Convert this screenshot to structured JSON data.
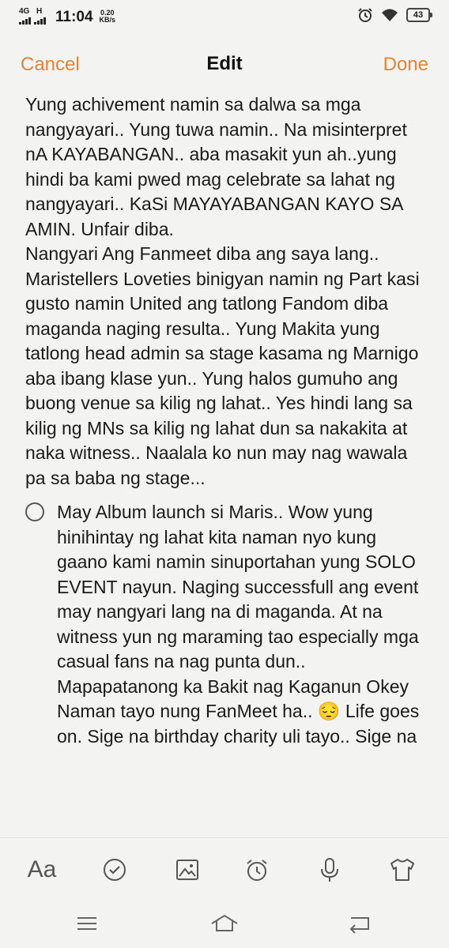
{
  "status_bar": {
    "network_type": "4G",
    "network_sub": "H",
    "time": "11:04",
    "speed_value": "0.20",
    "speed_unit": "KB/s",
    "battery": "43",
    "icons": [
      "signal-bars-icon",
      "alarm-clock-icon",
      "wifi-icon",
      "battery-icon"
    ]
  },
  "nav": {
    "cancel_label": "Cancel",
    "title": "Edit",
    "done_label": "Done",
    "accent_color": "#e0853a"
  },
  "note": {
    "paragraphs": [
      "Yung achivement namin sa dalwa sa mga nangyayari.. Yung tuwa namin.. Na misinterpret nA KAYABANGAN.. aba masakit yun ah..yung hindi ba kami pwed mag celebrate sa lahat ng nangyayari.. KaSi MAYAYABANGAN KAYO SA AMIN. Unfair diba.",
      "Nangyari Ang Fanmeet diba ang saya lang.. Maristellers Loveties binigyan namin ng Part kasi gusto namin United ang tatlong Fandom diba maganda naging resulta.. Yung Makita yung tatlong head admin sa stage kasama ng Marnigo aba ibang klase yun.. Yung halos gumuho ang buong venue sa kilig ng lahat.. Yes hindi lang sa kilig ng MNs sa kilig ng lahat dun sa nakakita at naka witness.. Naalala ko nun may nag wawala pa sa baba ng stage..."
    ],
    "checklist_item": "May Album launch si Maris.. Wow yung hinihintay ng lahat kita naman nyo kung gaano kami namin sinuportahan yung SOLO EVENT nayun. Naging successfull ang event may nangyari lang na di maganda. At na witness yun ng maraming tao especially mga casual fans na nag punta dun.. Mapapatanong ka Bakit nag Kaganun Okey Naman tayo nung FanMeet ha.. 😔 Life goes on.  Sige na birthday charity uli tayo.. Sige na"
  },
  "toolbar": {
    "format_label": "Aa",
    "icons": [
      "text-format-icon",
      "checklist-icon",
      "image-icon",
      "reminder-clock-icon",
      "microphone-icon",
      "theme-shirt-icon"
    ]
  },
  "navkeys": {
    "icons": [
      "menu-icon",
      "home-icon",
      "back-icon"
    ]
  }
}
